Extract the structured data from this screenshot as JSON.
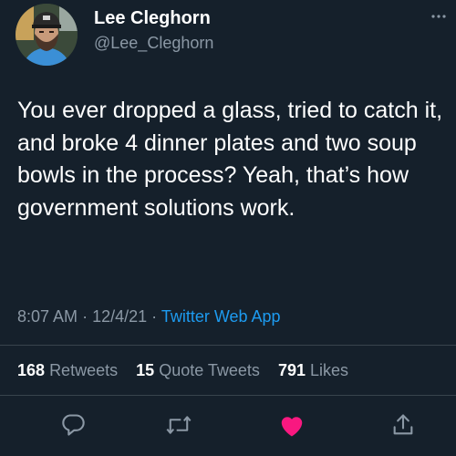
{
  "user": {
    "display_name": "Lee Cleghorn",
    "handle": "@Lee_Cleghorn"
  },
  "menu_icon": "more-dots-icon",
  "tweet": {
    "text": "You ever dropped a glass, tried to catch it, and broke 4 dinner plates and two soup bowls in the process? Yeah, that’s how government solutions work."
  },
  "meta": {
    "time": "8:07 AM",
    "date": "12/4/21",
    "separator": "·",
    "source": "Twitter Web App"
  },
  "stats": {
    "retweets_count": "168",
    "retweets_label": "Retweets",
    "quotes_count": "15",
    "quotes_label": "Quote Tweets",
    "likes_count": "791",
    "likes_label": "Likes"
  },
  "actions": [
    {
      "icon": "reply-icon"
    },
    {
      "icon": "retweet-icon"
    },
    {
      "icon": "like-heart-icon",
      "color": "#f91880"
    },
    {
      "icon": "share-icon"
    }
  ],
  "colors": {
    "background": "#15202b",
    "text_primary": "#ffffff",
    "text_secondary": "#8b98a5",
    "link": "#1d9bf0",
    "like": "#f91880",
    "divider": "#38444d"
  }
}
